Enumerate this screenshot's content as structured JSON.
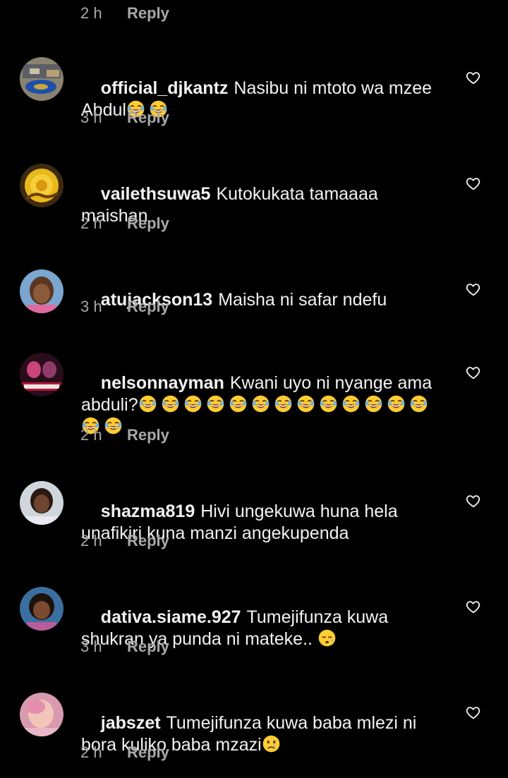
{
  "top_meta": {
    "time": "2 h",
    "reply": "Reply"
  },
  "comments": [
    {
      "username": "official_djkantz",
      "text": "Nasibu ni mtoto wa mzee Abdul",
      "emojis": [
        "joy",
        "joy"
      ],
      "time": "3 h",
      "reply": "Reply"
    },
    {
      "username": "vailethsuwa5",
      "text": "Kutokukata tamaaaa maishan",
      "emojis": [],
      "time": "2 h",
      "reply": "Reply"
    },
    {
      "username": "atujackson13",
      "text": "Maisha ni safar ndefu",
      "emojis": [],
      "time": "3 h",
      "reply": "Reply"
    },
    {
      "username": "nelsonnayman",
      "text": "Kwani uyo ni nyange ama abduli?",
      "emojis": [
        "joy",
        "joy",
        "joy",
        "joy",
        "joy",
        "joy",
        "joy",
        "joy",
        "joy",
        "joy",
        "joy",
        "joy",
        "joy",
        "joy",
        "joy"
      ],
      "time": "2 h",
      "reply": "Reply"
    },
    {
      "username": "shazma819",
      "text": "Hivi ungekuwa huna hela unafikiri kuna manzi angekupenda",
      "emojis": [],
      "time": "2 h",
      "reply": "Reply"
    },
    {
      "username": "dativa.siame.927",
      "text": "Tumejifunza kuwa shukran ya punda ni mateke..",
      "emojis": [
        "sleepy"
      ],
      "time": "3 h",
      "reply": "Reply"
    },
    {
      "username": "jabszet",
      "text": "Tumejifunza kuwa baba mlezi ni bora kuliko baba mzazi",
      "emojis": [
        "cry"
      ],
      "time": "2 h",
      "reply": "Reply"
    }
  ],
  "icons": {
    "like": "heart-outline-icon"
  },
  "colors": {
    "background": "#000000",
    "text": "#f2f2f2",
    "muted": "#a8a8a8"
  }
}
